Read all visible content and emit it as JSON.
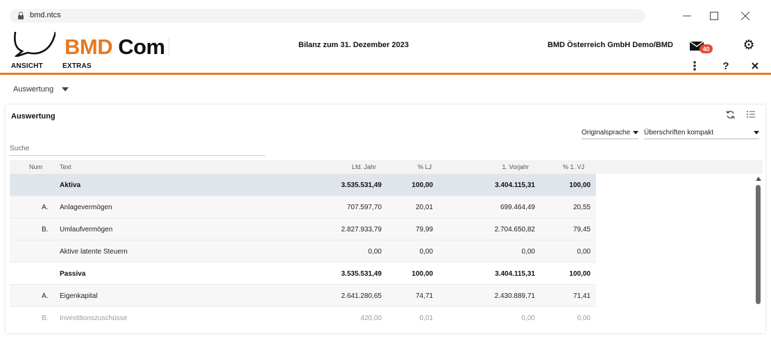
{
  "browser": {
    "url": "bmd.ntcs"
  },
  "header": {
    "logo_left": "BMD",
    "logo_right": "Com",
    "menu": [
      "ANSICHT",
      "EXTRAS"
    ],
    "document_title": "Bilanz zum 31. Dezember 2023",
    "company": "BMD Österreich GmbH Demo/BMD",
    "mail_count": "40",
    "accent_color": "#e8781e",
    "badge_color": "#e34a3c"
  },
  "section": {
    "label": "Auswertung"
  },
  "panel": {
    "title": "Auswertung",
    "language_select": "Originalsprache",
    "headings_select": "Überschriften kompakt",
    "search_placeholder": "Suche"
  },
  "table": {
    "columns": {
      "num": "Num",
      "text": "Text",
      "lfd_jahr": "Lfd. Jahr",
      "pct_lj": "% LJ",
      "vorjahr": "1. Vorjahr",
      "pct_vj": "% 1. VJ"
    },
    "rows": [
      {
        "num": "",
        "text": "Aktiva",
        "lfd": "3.535.531,49",
        "pct_lj": "100,00",
        "vj": "3.404.115,31",
        "pct_vj": "100,00"
      },
      {
        "num": "A.",
        "text": "Anlagevermögen",
        "lfd": "707.597,70",
        "pct_lj": "20,01",
        "vj": "699.464,49",
        "pct_vj": "20,55"
      },
      {
        "num": "B.",
        "text": "Umlaufvermögen",
        "lfd": "2.827.933,79",
        "pct_lj": "79,99",
        "vj": "2.704.650,82",
        "pct_vj": "79,45"
      },
      {
        "num": "",
        "text": "Aktive latente Steuern",
        "lfd": "0,00",
        "pct_lj": "0,00",
        "vj": "0,00",
        "pct_vj": "0,00"
      },
      {
        "num": "",
        "text": "Passiva",
        "lfd": "3.535.531,49",
        "pct_lj": "100,00",
        "vj": "3.404.115,31",
        "pct_vj": "100,00"
      },
      {
        "num": "A.",
        "text": "Eigenkapital",
        "lfd": "2.641.280,65",
        "pct_lj": "74,71",
        "vj": "2.430.889,71",
        "pct_vj": "71,41"
      },
      {
        "num": "B.",
        "text": "Investitionszuschüsse",
        "lfd": "420,00",
        "pct_lj": "0,01",
        "vj": "0,00",
        "pct_vj": "0,00"
      }
    ]
  }
}
